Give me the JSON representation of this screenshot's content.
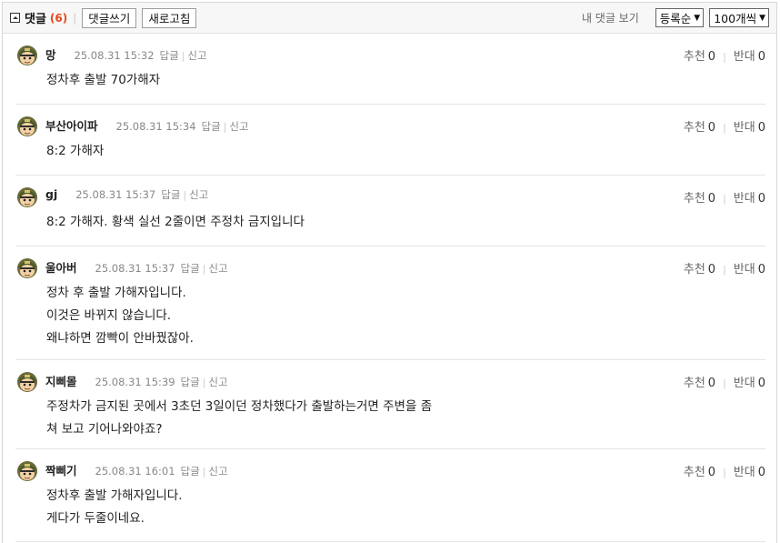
{
  "header": {
    "title": "댓글",
    "count": "(6)",
    "write_label": "댓글쓰기",
    "refresh_label": "새로고침",
    "my_comments_label": "내 댓글 보기",
    "sort_value": "등록순",
    "per_page_value": "100개씩"
  },
  "vote_labels": {
    "up": "추천",
    "down": "반대",
    "reply": "답글",
    "report": "신고"
  },
  "comments": [
    {
      "nick": "망",
      "date": "25.08.31 15:32",
      "up": "0",
      "down": "0",
      "lines": [
        "정차후 출발 70가해자"
      ]
    },
    {
      "nick": "부산아이파",
      "date": "25.08.31 15:34",
      "up": "0",
      "down": "0",
      "lines": [
        "8:2 가해자"
      ]
    },
    {
      "nick": "gj",
      "date": "25.08.31 15:37",
      "up": "0",
      "down": "0",
      "lines": [
        "8:2 가해자. 황색 실선 2줄이면 주정차 금지입니다"
      ]
    },
    {
      "nick": "울아버",
      "date": "25.08.31 15:37",
      "up": "0",
      "down": "0",
      "lines": [
        "정차 후 출발 가해자입니다.",
        "이것은 바뀌지 않습니다.",
        "왜냐하면 깜빡이 안바꿨잖아."
      ]
    },
    {
      "nick": "지삐몰",
      "date": "25.08.31 15:39",
      "up": "0",
      "down": "0",
      "lines": [
        "주정차가 금지된 곳에서 3초던 3일이던 정차했다가 출발하는거면 주변을 좀",
        "쳐 보고 기어나와야죠?"
      ]
    },
    {
      "nick": "짝삐기",
      "date": "25.08.31 16:01",
      "up": "0",
      "down": "0",
      "lines": [
        "정차후 출발 가해자입니다.",
        "게다가 두줄이네요."
      ]
    }
  ],
  "avatar_icon": "soldier-avatar-icon",
  "colors": {
    "count": "#e8461c",
    "header_bg": "#f7f7f7"
  }
}
